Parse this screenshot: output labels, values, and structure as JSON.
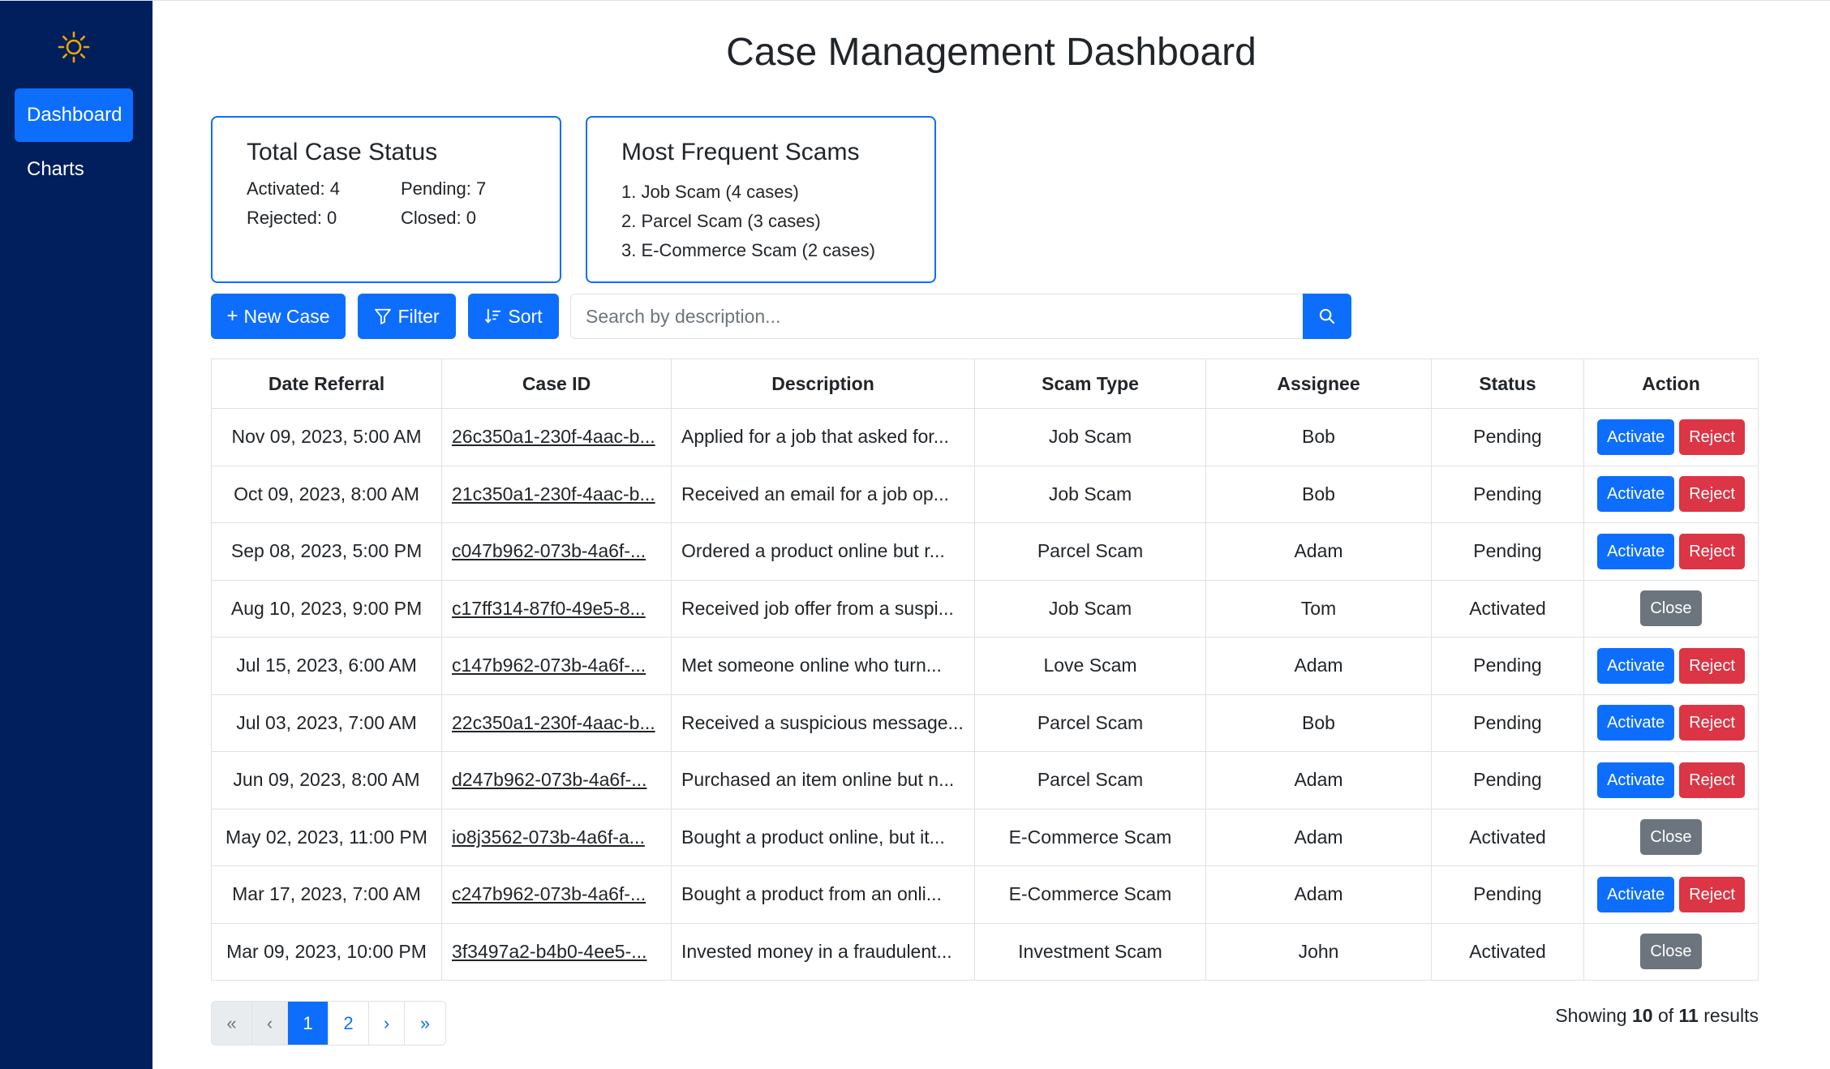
{
  "sidebar": {
    "theme_icon": "sun-icon",
    "items": [
      {
        "label": "Dashboard",
        "active": true
      },
      {
        "label": "Charts",
        "active": false
      }
    ]
  },
  "header": {
    "title": "Case Management Dashboard"
  },
  "status_card": {
    "title": "Total Case Status",
    "activated": "Activated: 4",
    "pending": "Pending: 7",
    "rejected": "Rejected: 0",
    "closed": "Closed: 0"
  },
  "scams_card": {
    "title": "Most Frequent Scams",
    "items": [
      "1. Job Scam (4 cases)",
      "2. Parcel Scam (3 cases)",
      "3. E-Commerce Scam (2 cases)"
    ]
  },
  "toolbar": {
    "new_case_label": "New Case",
    "filter_label": "Filter",
    "sort_label": "Sort",
    "search_placeholder": "Search by description...",
    "search_icon": "search-icon"
  },
  "table": {
    "headers": [
      "Date Referral",
      "Case ID",
      "Description",
      "Scam Type",
      "Assignee",
      "Status",
      "Action"
    ],
    "rows": [
      {
        "date": "Nov 09, 2023, 5:00 AM",
        "case_id": "26c350a1-230f-4aac-b...",
        "description": "Applied for a job that asked for...",
        "scam_type": "Job Scam",
        "assignee": "Bob",
        "status": "Pending",
        "actions": [
          "Activate",
          "Reject"
        ]
      },
      {
        "date": "Oct 09, 2023, 8:00 AM",
        "case_id": "21c350a1-230f-4aac-b...",
        "description": "Received an email for a job op...",
        "scam_type": "Job Scam",
        "assignee": "Bob",
        "status": "Pending",
        "actions": [
          "Activate",
          "Reject"
        ]
      },
      {
        "date": "Sep 08, 2023, 5:00 PM",
        "case_id": "c047b962-073b-4a6f-...",
        "description": "Ordered a product online but r...",
        "scam_type": "Parcel Scam",
        "assignee": "Adam",
        "status": "Pending",
        "actions": [
          "Activate",
          "Reject"
        ]
      },
      {
        "date": "Aug 10, 2023, 9:00 PM",
        "case_id": "c17ff314-87f0-49e5-8...",
        "description": "Received job offer from a suspi...",
        "scam_type": "Job Scam",
        "assignee": "Tom",
        "status": "Activated",
        "actions": [
          "Close"
        ]
      },
      {
        "date": "Jul 15, 2023, 6:00 AM",
        "case_id": "c147b962-073b-4a6f-...",
        "description": "Met someone online who turn...",
        "scam_type": "Love Scam",
        "assignee": "Adam",
        "status": "Pending",
        "actions": [
          "Activate",
          "Reject"
        ]
      },
      {
        "date": "Jul 03, 2023, 7:00 AM",
        "case_id": "22c350a1-230f-4aac-b...",
        "description": "Received a suspicious message...",
        "scam_type": "Parcel Scam",
        "assignee": "Bob",
        "status": "Pending",
        "actions": [
          "Activate",
          "Reject"
        ]
      },
      {
        "date": "Jun 09, 2023, 8:00 AM",
        "case_id": "d247b962-073b-4a6f-...",
        "description": "Purchased an item online but n...",
        "scam_type": "Parcel Scam",
        "assignee": "Adam",
        "status": "Pending",
        "actions": [
          "Activate",
          "Reject"
        ]
      },
      {
        "date": "May 02, 2023, 11:00 PM",
        "case_id": "io8j3562-073b-4a6f-a...",
        "description": "Bought a product online, but it...",
        "scam_type": "E-Commerce Scam",
        "assignee": "Adam",
        "status": "Activated",
        "actions": [
          "Close"
        ]
      },
      {
        "date": "Mar 17, 2023, 7:00 AM",
        "case_id": "c247b962-073b-4a6f-...",
        "description": "Bought a product from an onli...",
        "scam_type": "E-Commerce Scam",
        "assignee": "Adam",
        "status": "Pending",
        "actions": [
          "Activate",
          "Reject"
        ]
      },
      {
        "date": "Mar 09, 2023, 10:00 PM",
        "case_id": "3f3497a2-b4b0-4ee5-...",
        "description": "Invested money in a fraudulent...",
        "scam_type": "Investment Scam",
        "assignee": "John",
        "status": "Activated",
        "actions": [
          "Close"
        ]
      }
    ]
  },
  "pagination": {
    "first": "«",
    "prev": "‹",
    "pages": [
      "1",
      "2"
    ],
    "current": "1",
    "next": "›",
    "last": "»"
  },
  "results": {
    "prefix": "Showing",
    "shown": "10",
    "middle": "of",
    "total": "11",
    "suffix": "results"
  },
  "colors": {
    "sidebar_bg": "#001f5c",
    "primary": "#0d6efd",
    "danger": "#dc3545",
    "secondary": "#6c757d",
    "sun": "#f0a500"
  }
}
